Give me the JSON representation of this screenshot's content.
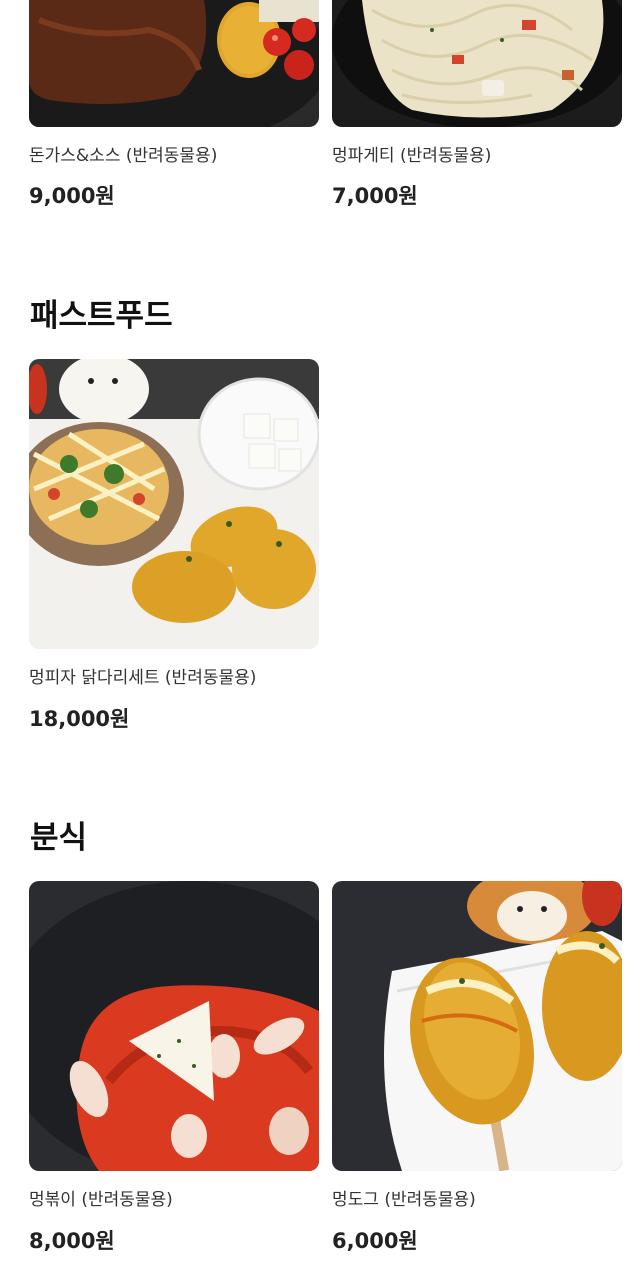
{
  "sections": [
    {
      "title": "",
      "items": [
        {
          "name": "돈가스&소스 (반려동물용)",
          "price": "9,000원",
          "image_icon": "tonkatsu-plate-image"
        },
        {
          "name": "멍파게티 (반려동물용)",
          "price": "7,000원",
          "image_icon": "spaghetti-plate-image"
        }
      ]
    },
    {
      "title": "패스트푸드",
      "items": [
        {
          "name": "멍피자 닭다리세트 (반려동물용)",
          "price": "18,000원",
          "image_icon": "pizza-drumstick-set-image"
        }
      ]
    },
    {
      "title": "분식",
      "items": [
        {
          "name": "멍볶이 (반려동물용)",
          "price": "8,000원",
          "image_icon": "tteokbokki-image"
        },
        {
          "name": "멍도그 (반려동물용)",
          "price": "6,000원",
          "image_icon": "corndog-image"
        }
      ]
    }
  ],
  "colors": {
    "plate": "#1a1a1a",
    "sauce": "#5a2a16",
    "fried": "#e0a72a",
    "tomato": "#d62a20"
  }
}
